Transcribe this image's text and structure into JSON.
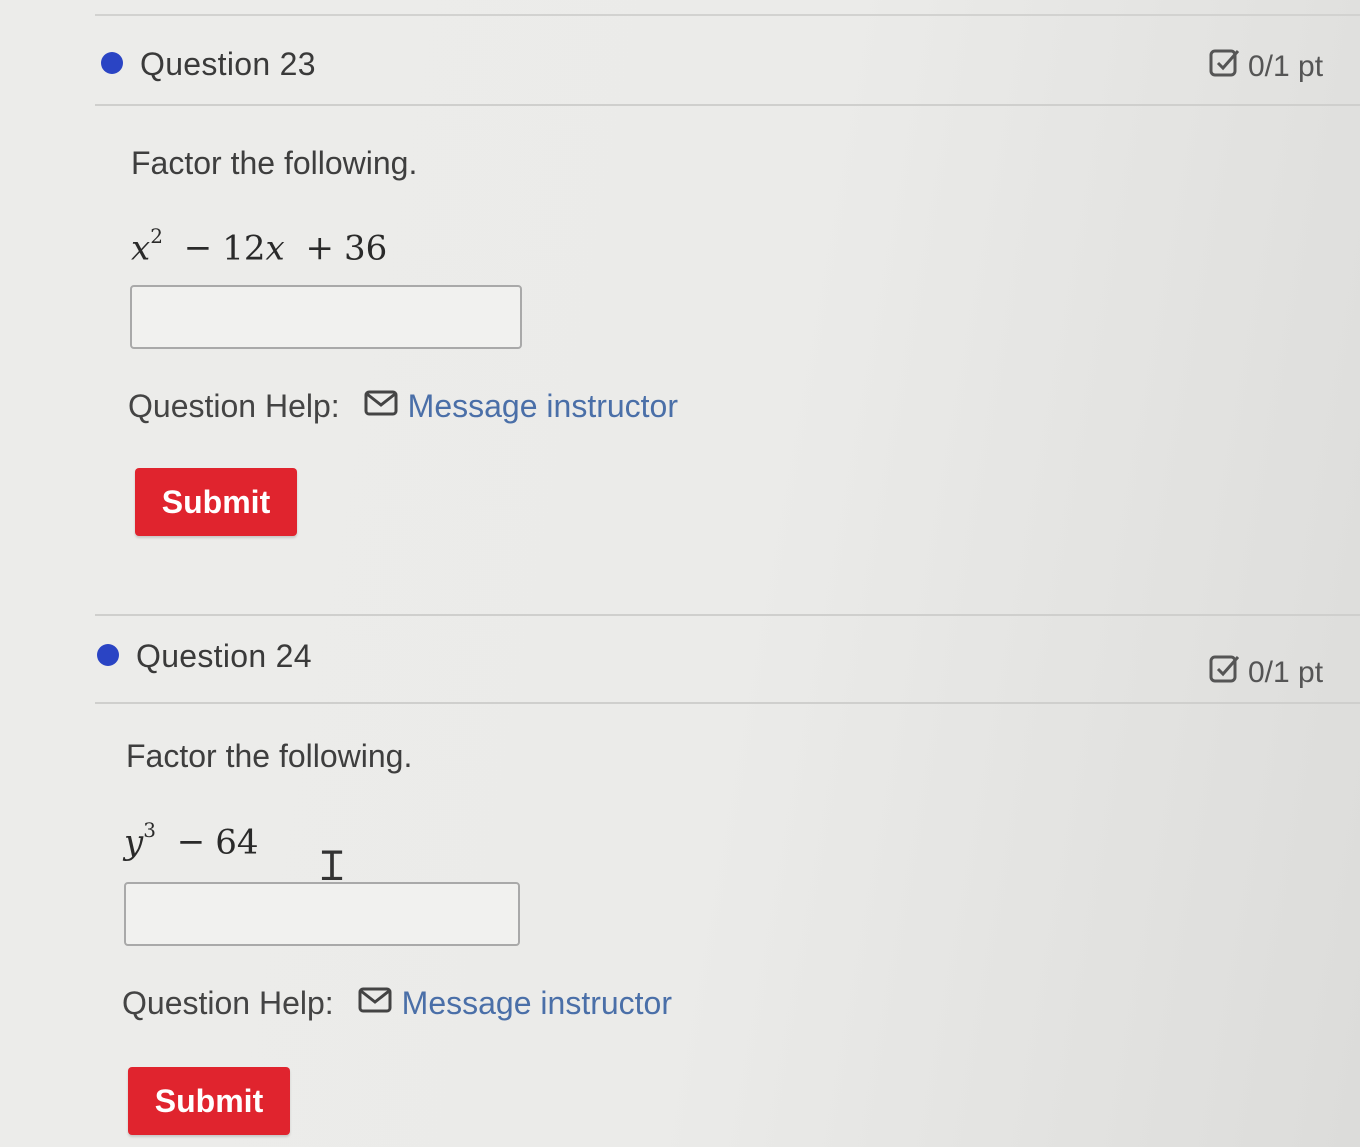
{
  "questions": [
    {
      "title": "Question 23",
      "score": "0/1 pt",
      "prompt": "Factor the following.",
      "expression": {
        "variable": "x",
        "exponent": "2",
        "rest_op1": "−",
        "rest_coef": "12",
        "rest_var": "x",
        "rest_op2": "+",
        "rest_const": "36"
      },
      "answer_value": "",
      "help_label": "Question Help:",
      "help_link": "Message instructor",
      "submit_label": "Submit"
    },
    {
      "title": "Question 24",
      "score": "0/1 pt",
      "prompt": "Factor the following.",
      "expression": {
        "variable": "y",
        "exponent": "3",
        "rest_op1": "−",
        "rest_const": "64"
      },
      "answer_value": "",
      "help_label": "Question Help:",
      "help_link": "Message instructor",
      "submit_label": "Submit"
    }
  ],
  "colors": {
    "bullet": "#2a44c4",
    "submit": "#e0242e",
    "link": "#4a6fa8"
  },
  "icons": [
    "bullet-dot-icon",
    "edit-check-icon",
    "mail-icon",
    "text-cursor-icon"
  ]
}
